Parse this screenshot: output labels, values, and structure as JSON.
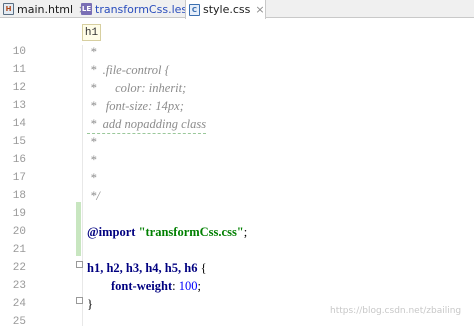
{
  "tabs": [
    {
      "label": "main.html",
      "icon": "html-file-icon",
      "active": false
    },
    {
      "label": "transformCss.less",
      "icon": "less-file-icon",
      "active": false
    },
    {
      "label": "style.css",
      "icon": "css-file-icon",
      "active": true
    }
  ],
  "tab_close_glyph": "×",
  "breadcrumb": {
    "tag": "h1"
  },
  "editor": {
    "lines": [
      {
        "number": "10",
        "text": " *"
      },
      {
        "number": "11",
        "text": " *  .file-control {"
      },
      {
        "number": "12",
        "text": " *      color: inherit;"
      },
      {
        "number": "13",
        "text": " *   font-size: 14px;"
      },
      {
        "number": "14",
        "text": " *  add nopadding class"
      },
      {
        "number": "15",
        "text": " *"
      },
      {
        "number": "16",
        "text": " *"
      },
      {
        "number": "17",
        "text": " *"
      },
      {
        "number": "18",
        "text": " */"
      },
      {
        "number": "19",
        "text": ""
      },
      {
        "number": "20",
        "keyword": "@import",
        "string": "\"transformCss.css\"",
        "semicolon": ";"
      },
      {
        "number": "21",
        "text": ""
      },
      {
        "number": "22",
        "selector": "h1, h2, h3, h4, h5, h6",
        "brace": " {"
      },
      {
        "number": "23",
        "property": "font-weight",
        "colon": ": ",
        "value": "100",
        "semicolon": ";"
      },
      {
        "number": "24",
        "text": "}"
      },
      {
        "number": "25",
        "text": ""
      }
    ]
  },
  "watermark": "https://blog.csdn.net/zbailing",
  "colors": {
    "comment": "#8c8c8c",
    "keyword": "#000080",
    "string": "#008000",
    "number": "#0000ff",
    "line_number": "#999999"
  }
}
